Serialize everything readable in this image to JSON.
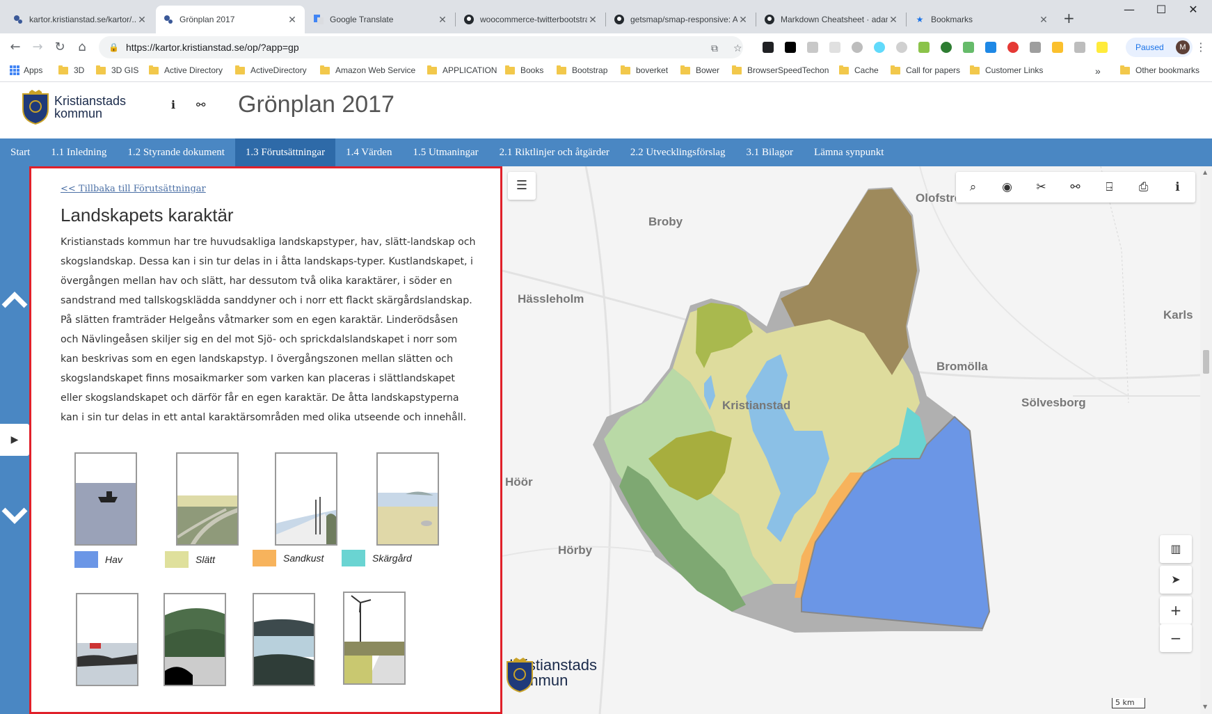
{
  "browser": {
    "tabs": [
      {
        "title": "kartor.kristianstad.se/kartor/..",
        "fav": "kommun-icon",
        "active": false
      },
      {
        "title": "Grönplan 2017",
        "fav": "kommun-icon",
        "active": true
      },
      {
        "title": "Google Translate",
        "fav": "translate-icon",
        "active": false
      },
      {
        "title": "woocommerce-twitterbootstrap",
        "fav": "github-icon",
        "active": false
      },
      {
        "title": "getsmap/smap-responsive: A",
        "fav": "github-icon",
        "active": false
      },
      {
        "title": "Markdown Cheatsheet · adam-p",
        "fav": "github-icon",
        "active": false
      },
      {
        "title": "Bookmarks",
        "fav": "star-icon",
        "active": false
      }
    ],
    "new_tab": "+",
    "url": "https://kartor.kristianstad.se/op/?app=gp",
    "profile_label": "Paused",
    "profile_initial": "M",
    "bookmarks": [
      "Apps",
      "3D",
      "3D GIS",
      "Active Directory",
      "ActiveDirectory",
      "Amazon Web Service",
      "APPLICATION",
      "Books",
      "Bootstrap",
      "boverket",
      "Bower",
      "BrowserSpeedTechon",
      "Cache",
      "Call for papers",
      "Customer Links"
    ],
    "bookmarks_overflow": "»",
    "other_bookmarks": "Other bookmarks"
  },
  "header": {
    "logo_line1": "Kristianstads",
    "logo_line2": "kommun",
    "title": "Grönplan 2017"
  },
  "nav": [
    "Start",
    "1.1 Inledning",
    "1.2 Styrande dokument",
    "1.3 Förutsättningar",
    "1.4 Värden",
    "1.5 Utmaningar",
    "2.1 Riktlinjer och åtgärder",
    "2.2 Utvecklingsförslag",
    "3.1 Bilagor",
    "Lämna synpunkt"
  ],
  "nav_active": 3,
  "panel": {
    "back_link": "<< Tillbaka till Förutsättningar",
    "heading": "Landskapets karaktär",
    "body": "Kristianstads kommun har tre huvudsakliga landskapstyper, hav, slätt-landskap och skogslandskap. Dessa kan i sin tur delas in i åtta landskaps-typer. Kustlandskapet, i övergången mellan hav och slätt, har dessutom två olika karaktärer, i söder en sandstrand med tallskogsklädda sanddyner och i norr ett flackt skärgårdslandskap. På slätten framträder Helgeåns våtmarker som en egen karaktär. Linderödsåsen och Nävlingeåsen skiljer sig en del mot Sjö- och sprickdalslandskapet i norr som kan beskrivas som en egen landskapstyp. I övergångszonen mellan slätten och skogslandskapet finns mosaikmarker som varken kan placeras i slättlandskapet eller skogslandskapet och därför får en egen karaktär. De åtta landskapstyperna kan i sin tur delas in ett antal karaktärsområden med olika utseende och innehåll.",
    "legend": [
      {
        "label": "Hav",
        "color": "#6b96e6"
      },
      {
        "label": "Slätt",
        "color": "#dfe09c"
      },
      {
        "label": "Sandkust",
        "color": "#f7b35c"
      },
      {
        "label": "Skärgård",
        "color": "#6ad4d2"
      }
    ]
  },
  "map": {
    "places": [
      {
        "name": "Broby"
      },
      {
        "name": "Olofström"
      },
      {
        "name": "Hässleholm"
      },
      {
        "name": "Bromölla"
      },
      {
        "name": "Karls"
      },
      {
        "name": "Kristianstad"
      },
      {
        "name": "Sölvesborg"
      },
      {
        "name": "Höör"
      },
      {
        "name": "Hörby"
      }
    ],
    "logo_line1": "Kristianstads",
    "logo_line2": "kommun",
    "scale": "5 km"
  }
}
